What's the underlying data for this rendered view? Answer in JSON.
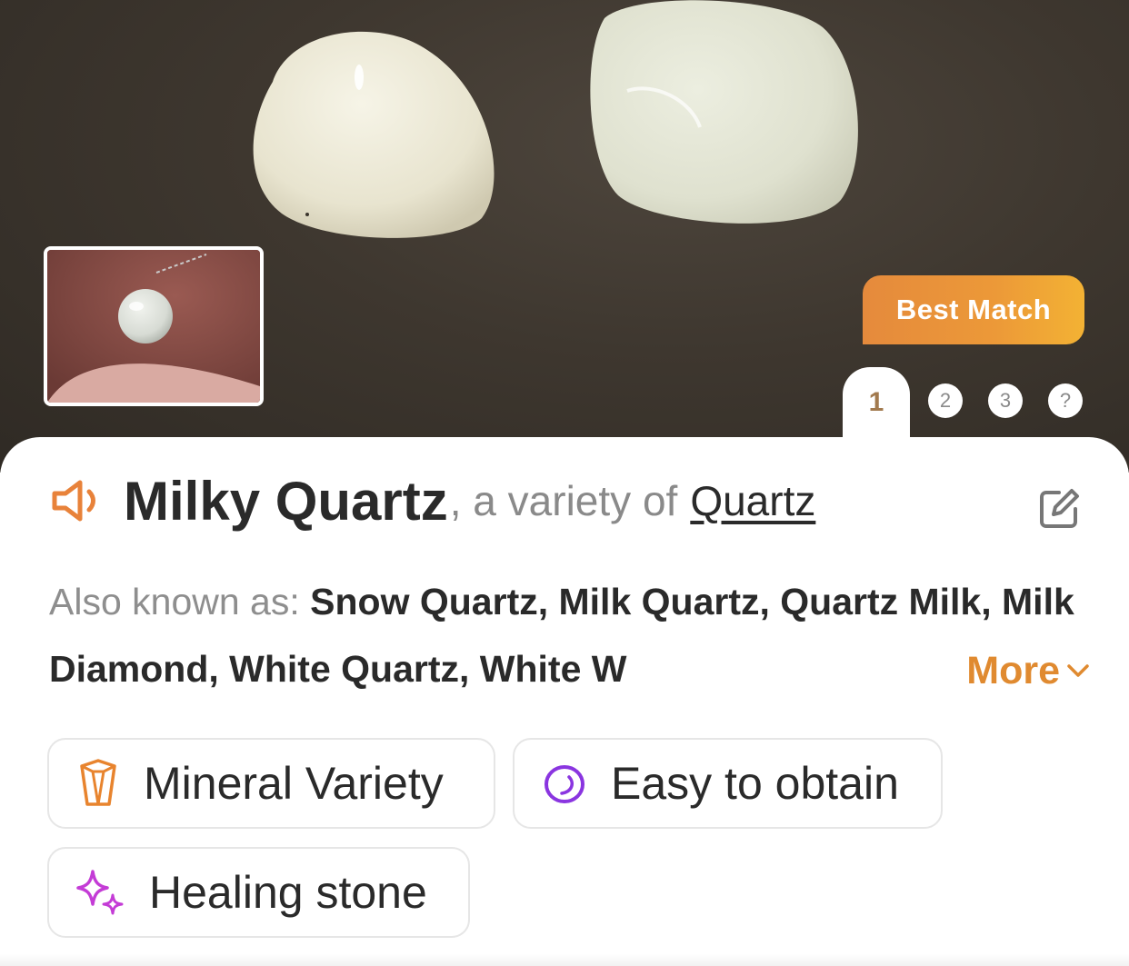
{
  "hero": {
    "badge_label": "Best Match",
    "pager": {
      "active": "1",
      "others": [
        "2",
        "3",
        "?"
      ]
    }
  },
  "result": {
    "name": "Milky Quartz",
    "variety_text": ", a variety of",
    "parent_name": "Quartz",
    "aka_label": "Also known as:",
    "aka_names": "Snow Quartz, Milk Quartz, Quartz Milk, Milk Diamond, White Quartz, White W",
    "more_label": "More"
  },
  "tags": [
    {
      "label": "Mineral Variety",
      "icon": "crystal-icon"
    },
    {
      "label": "Easy to obtain",
      "icon": "stone-ring-icon"
    },
    {
      "label": "Healing stone",
      "icon": "sparkle-icon"
    }
  ],
  "colors": {
    "accent_orange": "#e08a30",
    "badge_gradient": [
      "#e58a3c",
      "#f3b234"
    ],
    "title_text": "#2a2a2a",
    "muted_text": "#8a8a8a",
    "stone_icon_purple": "#8a35e0",
    "sparkle_icon_magenta": "#c43cd6"
  }
}
